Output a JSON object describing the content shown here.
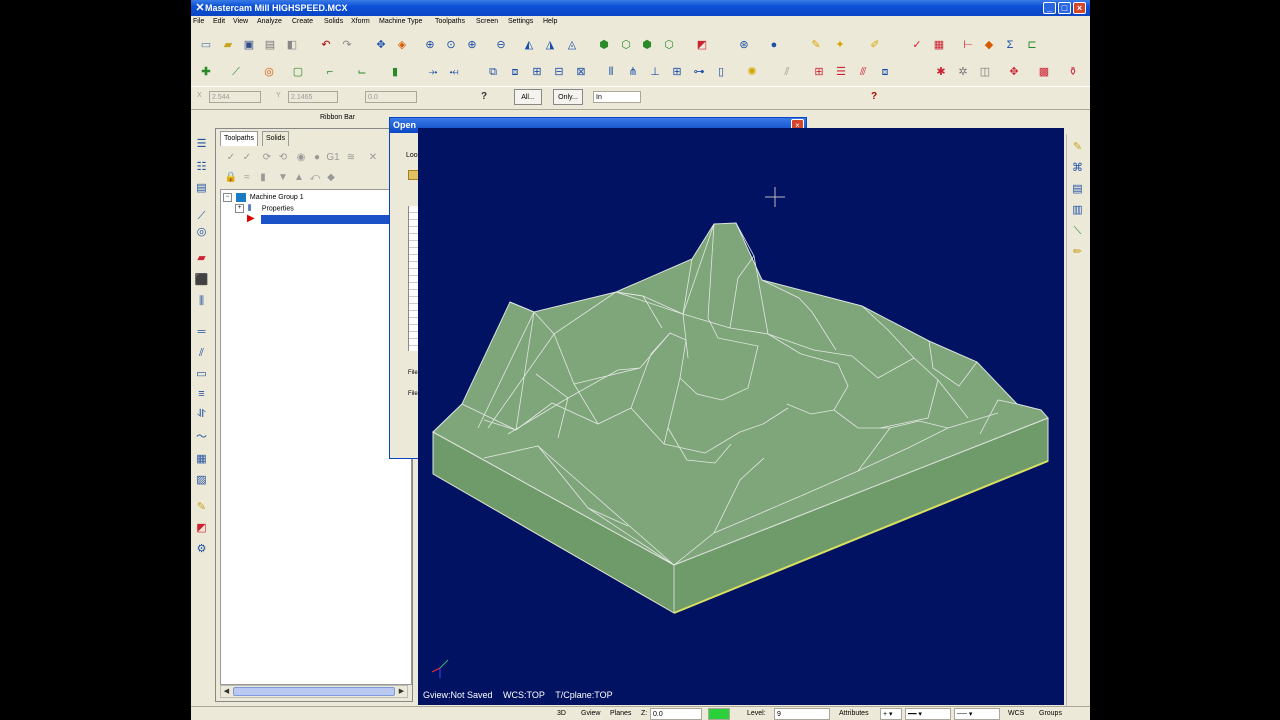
{
  "window": {
    "title": "Mastercam Mill  HIGHSPEED.MCX"
  },
  "menu": [
    "File",
    "Edit",
    "View",
    "Analyze",
    "Create",
    "Solids",
    "Xform",
    "Machine Type",
    "Toolpaths",
    "Screen",
    "Settings",
    "Help"
  ],
  "ribbon": {
    "x_label": "X",
    "x_value": "2.544",
    "y_label": "Y",
    "y_value": "2.1465",
    "z_value": "0.0",
    "all_label": "All...",
    "only_label": "Only...",
    "in_value": "In",
    "bar_label": "Ribbon Bar"
  },
  "manager": {
    "tabs": [
      "Toolpaths",
      "Solids"
    ],
    "tree": {
      "group": "Machine Group 1",
      "properties": "Properties"
    }
  },
  "dialog": {
    "title": "Open",
    "look_label": "Loo",
    "file_label_1": "File",
    "file_label_2": "File"
  },
  "viewport": {
    "gview": "Gview:Not Saved",
    "wcs": "WCS:TOP",
    "tcplane": "T/Cplane:TOP",
    "background_color": "#001261",
    "model_fill": "#7fa57a",
    "wire_color": "#d9dfd9"
  },
  "statusbar": {
    "mode": "3D",
    "gview": "Gview",
    "planes": "Planes",
    "z_label": "Z:",
    "z_value": "0.0",
    "color_value": "10",
    "level_label": "Level:",
    "level_value": "9",
    "attributes": "Attributes",
    "wcs": "WCS",
    "groups": "Groups"
  }
}
